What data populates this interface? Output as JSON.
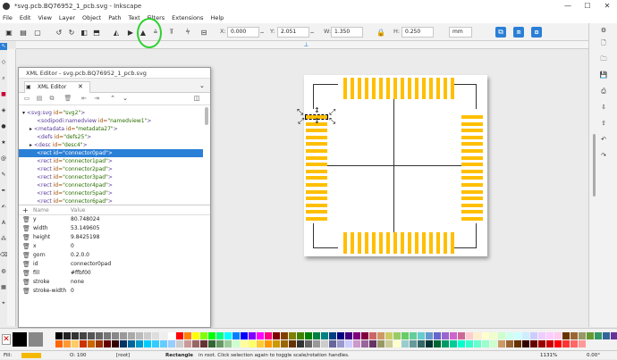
{
  "window": {
    "title": "*svg.pcb.BQ76952_1_pcb.svg - Inkscape",
    "controls": [
      "—",
      "☐",
      "✕"
    ]
  },
  "menu": [
    "File",
    "Edit",
    "View",
    "Layer",
    "Object",
    "Path",
    "Text",
    "Filters",
    "Extensions",
    "Help"
  ],
  "toolbar": {
    "x_label": "X:",
    "x_value": "0.000",
    "y_label": "Y:",
    "y_value": "2.051",
    "w_label": "W:",
    "w_value": "1.350",
    "h_label": "H:",
    "h_value": "0.250",
    "unit": "mm"
  },
  "xml_editor": {
    "window_title": "XML Editor - svg.pcb.BQ76952_1_pcb.svg",
    "tab_label": "XML Editor",
    "nodes": [
      {
        "text_tag": "<svg:svg",
        "attr": " id=",
        "val": "\"svg2\"",
        "close": ">"
      },
      {
        "text_tag": "<sodipodi:namedview",
        "attr": " id=",
        "val": "\"namedview1\"",
        "close": ">"
      },
      {
        "text_tag": "<metadata",
        "attr": " id=",
        "val": "\"metadata27\"",
        "close": ">"
      },
      {
        "text_tag": "<defs",
        "attr": " id=",
        "val": "\"defs25\"",
        "close": ">"
      },
      {
        "text_tag": "<desc",
        "attr": " id=",
        "val": "\"desc4\"",
        "close": ">"
      },
      {
        "text_tag": "<rect",
        "attr": " id=",
        "val": "\"connector0pad\"",
        "close": ">"
      },
      {
        "text_tag": "<rect",
        "attr": " id=",
        "val": "\"connector1pad\"",
        "close": ">"
      },
      {
        "text_tag": "<rect",
        "attr": " id=",
        "val": "\"connector2pad\"",
        "close": ">"
      },
      {
        "text_tag": "<rect",
        "attr": " id=",
        "val": "\"connector3pad\"",
        "close": ">"
      },
      {
        "text_tag": "<rect",
        "attr": " id=",
        "val": "\"connector4pad\"",
        "close": ">"
      },
      {
        "text_tag": "<rect",
        "attr": " id=",
        "val": "\"connector5pad\"",
        "close": ">"
      },
      {
        "text_tag": "<rect",
        "attr": " id=",
        "val": "\"connector6pad\"",
        "close": ">"
      }
    ],
    "attr_header": {
      "name": "Name",
      "value": "Value"
    },
    "attributes": [
      {
        "name": "y",
        "value": "80.748024"
      },
      {
        "name": "width",
        "value": "53.149605"
      },
      {
        "name": "height",
        "value": "9.8425198"
      },
      {
        "name": "x",
        "value": "0"
      },
      {
        "name": "gorn",
        "value": "0.2.0.0"
      },
      {
        "name": "id",
        "value": "connector0pad"
      },
      {
        "name": "fill",
        "value": "#ffbf00"
      },
      {
        "name": "stroke",
        "value": "none"
      },
      {
        "name": "stroke-width",
        "value": "0"
      }
    ]
  },
  "status": {
    "fill_label": "Fill:",
    "stroke_label": "Stroke:",
    "opacity_label": "O:",
    "opacity_value": "100",
    "layer": "[root]",
    "object": "Rectangle",
    "message": "in root. Click selection again to toggle scale/rotation handles.",
    "zoom_value": "1131%",
    "rotation_value": "0.00°"
  },
  "colors": {
    "accent": "#2a7fd6",
    "pad": "#ffbf00",
    "highlight": "#2fd02f"
  }
}
